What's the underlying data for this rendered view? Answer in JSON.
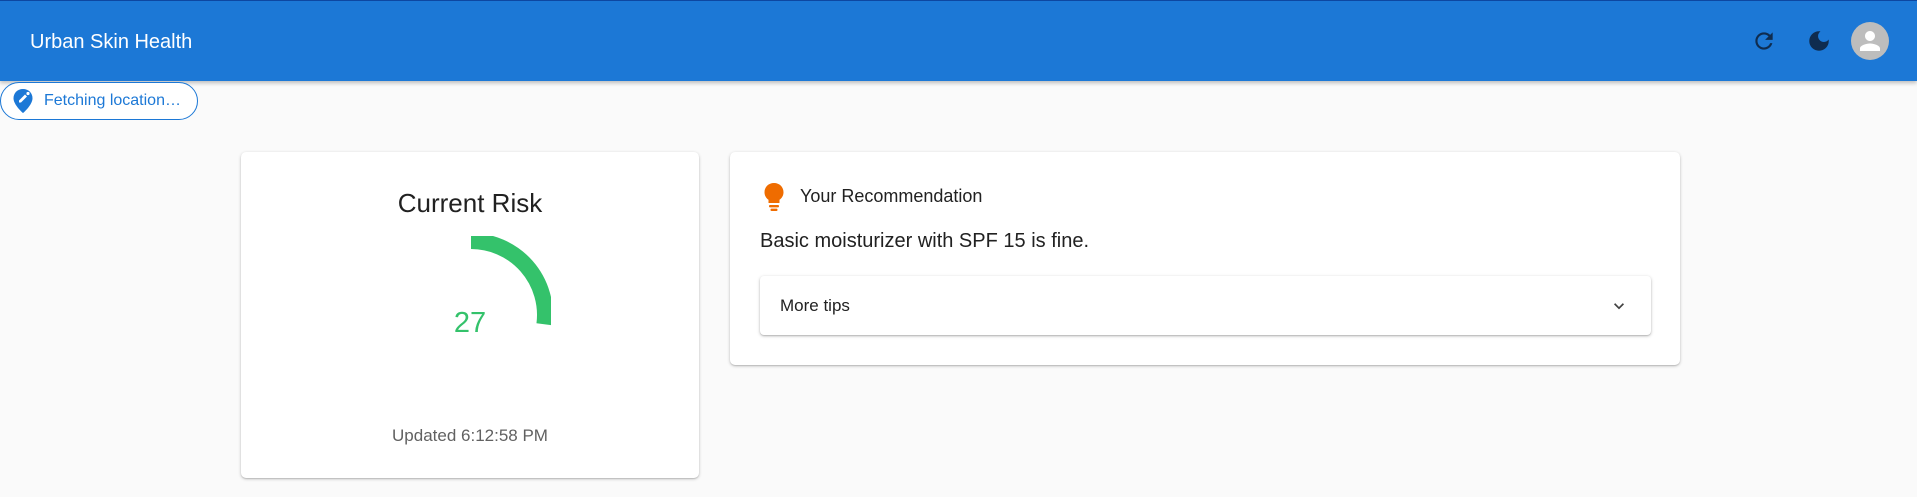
{
  "app": {
    "title": "Urban Skin Health"
  },
  "header": {
    "icons": [
      "refresh-icon",
      "dark-mode-moon-icon",
      "account-avatar-icon"
    ]
  },
  "location_chip": {
    "label": "Fetching location…",
    "icon": "location-pin-icon"
  },
  "risk_card": {
    "title": "Current Risk",
    "value": "27",
    "gauge_fraction": 0.27,
    "value_color": "#34c26b",
    "updated": "Updated 6:12:58 PM"
  },
  "recommendation": {
    "heading": "Your Recommendation",
    "icon": "lightbulb-icon",
    "text": "Basic moisturizer with SPF 15 is fine.",
    "more_tips_label": "More tips"
  },
  "colors": {
    "primary": "#1c78d6",
    "gauge": "#34c26b",
    "bulb": "#ef6c00"
  }
}
